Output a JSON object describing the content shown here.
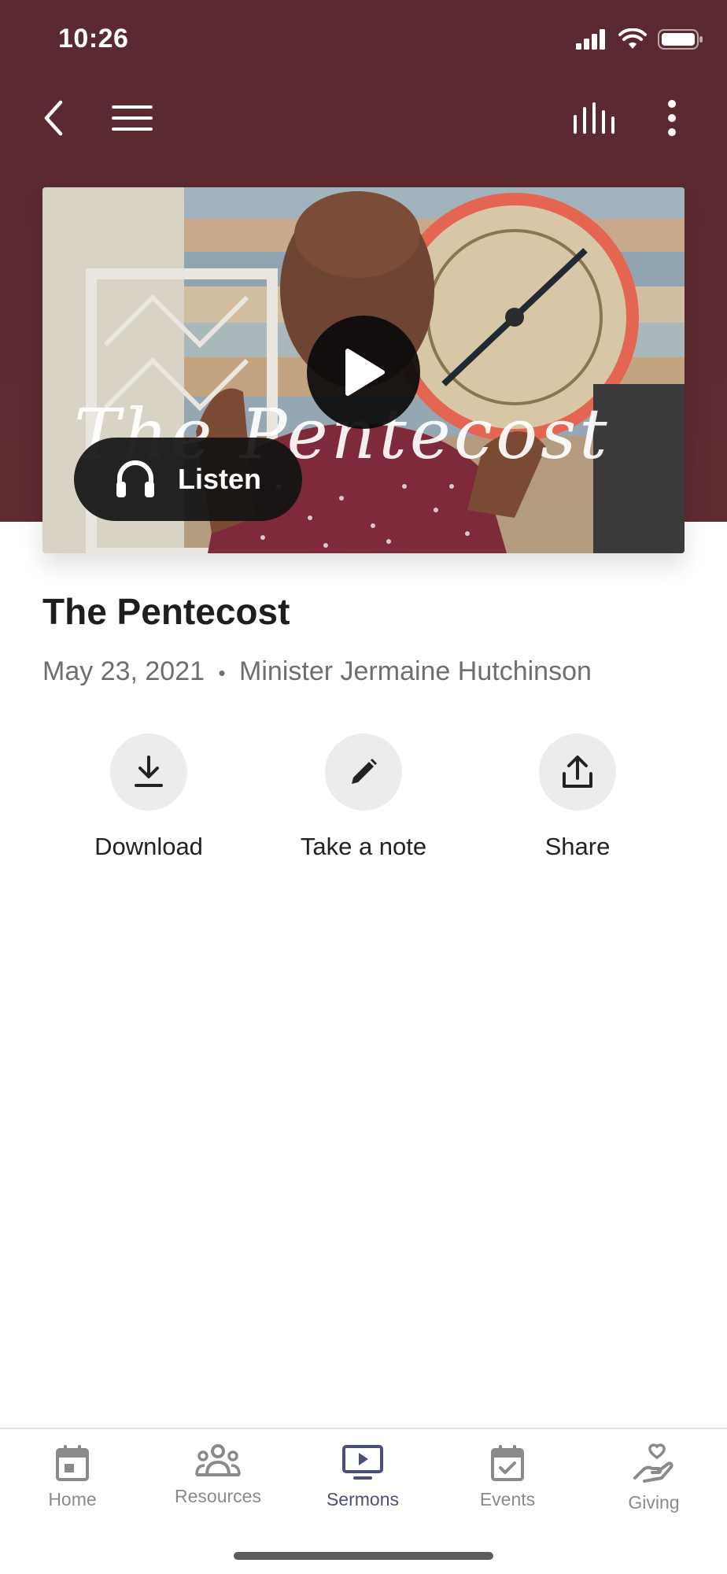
{
  "status_bar": {
    "time": "10:26"
  },
  "sermon": {
    "title": "The Pentecost",
    "date": "May 23, 2021",
    "separator": "•",
    "speaker": "Minister Jermaine Hutchinson",
    "video_overlay_text": "The Pentecost"
  },
  "player": {
    "listen_label": "Listen"
  },
  "actions": [
    {
      "label": "Download",
      "icon": "download-icon"
    },
    {
      "label": "Take a note",
      "icon": "pencil-icon"
    },
    {
      "label": "Share",
      "icon": "share-icon"
    }
  ],
  "tabs": [
    {
      "label": "Home",
      "icon": "home-calendar-icon",
      "active": false
    },
    {
      "label": "Resources",
      "icon": "people-icon",
      "active": false
    },
    {
      "label": "Sermons",
      "icon": "video-icon",
      "active": true
    },
    {
      "label": "Events",
      "icon": "calendar-check-icon",
      "active": false
    },
    {
      "label": "Giving",
      "icon": "hand-heart-icon",
      "active": false
    }
  ],
  "colors": {
    "header": "#5c2a30",
    "active_tab": "#4c4f7b",
    "inactive_tab": "#8a8a8a"
  }
}
